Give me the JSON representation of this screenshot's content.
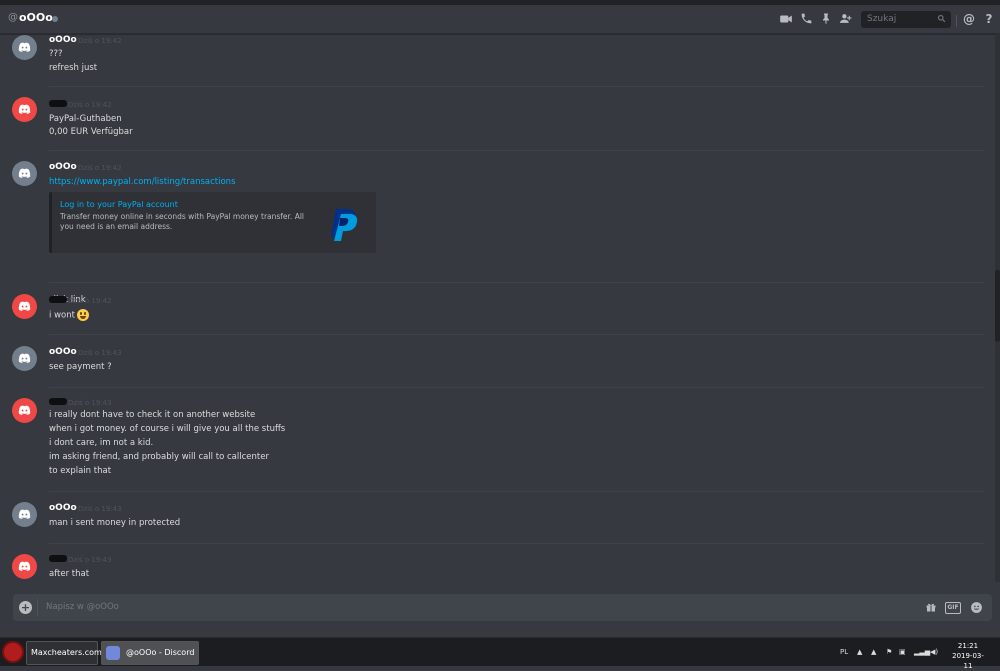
{
  "header": {
    "at_symbol": "@",
    "channel_name": "oOOo",
    "search_placeholder": "Szukaj",
    "at_button": "@",
    "help_button": "?"
  },
  "messages": [
    {
      "author": "oOOo",
      "timestamp": "Dziś o 19:42",
      "lines": [
        "???",
        "refresh just"
      ],
      "avatar": "gray"
    },
    {
      "author": "",
      "timestamp": "Dziś o 19:42",
      "lines": [
        "PayPal-Guthaben",
        "0,00 EUR Verfügbar"
      ],
      "avatar": "red"
    },
    {
      "author": "oOOo",
      "timestamp": "Dziś o 19:42",
      "link": "https://www.paypal.com/listing/transactions",
      "embed": {
        "title": "Log in to your PayPal account",
        "description": "Transfer money online in seconds with PayPal money transfer. All you need is an email address."
      },
      "lines_after": [
        "click link"
      ],
      "avatar": "gray"
    },
    {
      "author": "",
      "timestamp": "Dziś o 19:42",
      "lines": [
        "i wont"
      ],
      "avatar": "red"
    },
    {
      "author": "oOOo",
      "timestamp": "Dziś o 19:43",
      "lines": [
        "see payment ?"
      ],
      "avatar": "gray"
    },
    {
      "author": "",
      "timestamp": "Dziś o 19:43",
      "lines": [
        "i really dont have to check it on another website",
        "when i got money. of course i will give you all the stuffs",
        "i dont care, im not a kid.",
        "im asking friend, and probably will call to callcenter",
        "to explain that"
      ],
      "avatar": "red"
    },
    {
      "author": "oOOo",
      "timestamp": "Dziś o 19:43",
      "lines": [
        "man i sent money in protected"
      ],
      "avatar": "gray"
    },
    {
      "author": "",
      "timestamp": "Dziś o 19:43",
      "lines": [
        "after that"
      ],
      "avatar": "red"
    }
  ],
  "composer": {
    "placeholder": "Napisz w @oOOo",
    "gif_label": "GIF"
  },
  "taskbar": {
    "tasks": [
      {
        "label": "Maxcheaters.com..."
      },
      {
        "label": "@oOOo - Discord"
      }
    ],
    "lang": "PL",
    "time": "21:21",
    "date": "2019-03-11"
  },
  "colors": {
    "background": "#36393f",
    "link": "#00b0f4",
    "red_avatar": "#f04747",
    "gray_avatar": "#747f8d",
    "paypal_dark": "#003087",
    "paypal_light": "#009cde"
  }
}
